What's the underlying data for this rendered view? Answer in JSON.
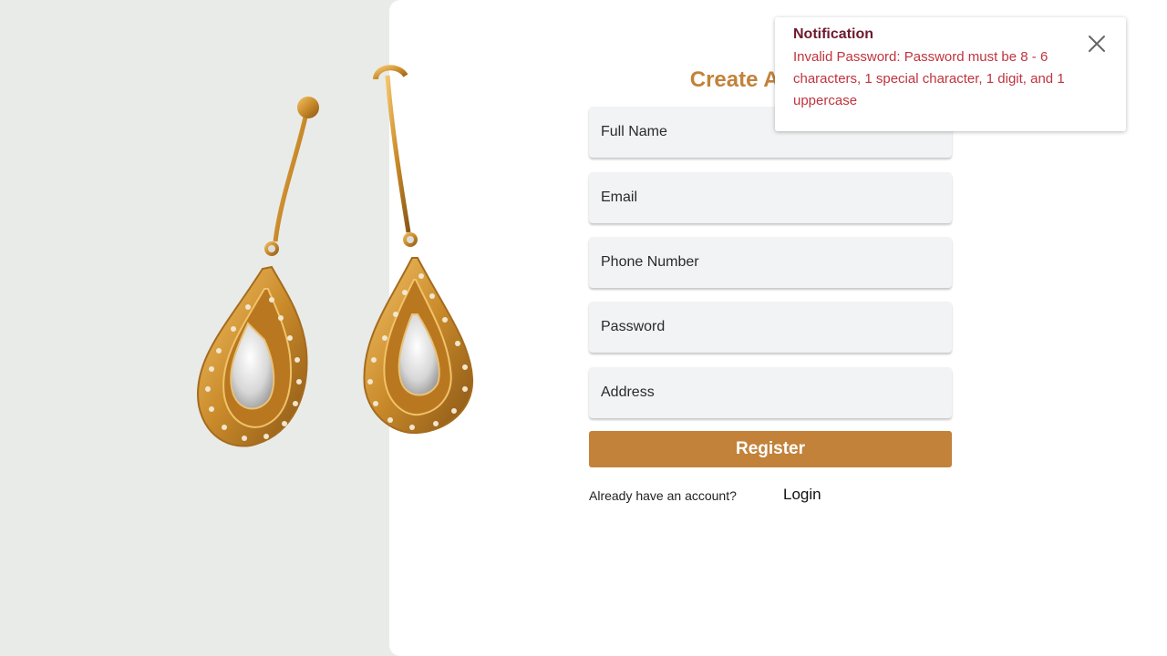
{
  "form": {
    "title": "Create Account",
    "fields": {
      "full_name": {
        "placeholder": "Full Name",
        "value": ""
      },
      "email": {
        "placeholder": "Email",
        "value": ""
      },
      "phone": {
        "placeholder": "Phone Number",
        "value": ""
      },
      "password": {
        "placeholder": "Password",
        "value": ""
      },
      "address": {
        "placeholder": "Address",
        "value": ""
      }
    },
    "register_label": "Register",
    "already_text": "Already have an account?",
    "login_label": "Login"
  },
  "notification": {
    "title": "Notification",
    "message": "Invalid Password: Password must be 8 - 6 characters, 1 special character, 1 digit, and 1 uppercase",
    "close_icon": "close-icon"
  },
  "hero_image": {
    "subject": "gold-teardrop-earrings"
  },
  "colors": {
    "accent": "#c3823a",
    "left_panel_bg": "#e9ebe8",
    "notification_title": "#6e1a2e",
    "notification_message": "#c0343e",
    "field_bg": "#f2f3f5"
  }
}
